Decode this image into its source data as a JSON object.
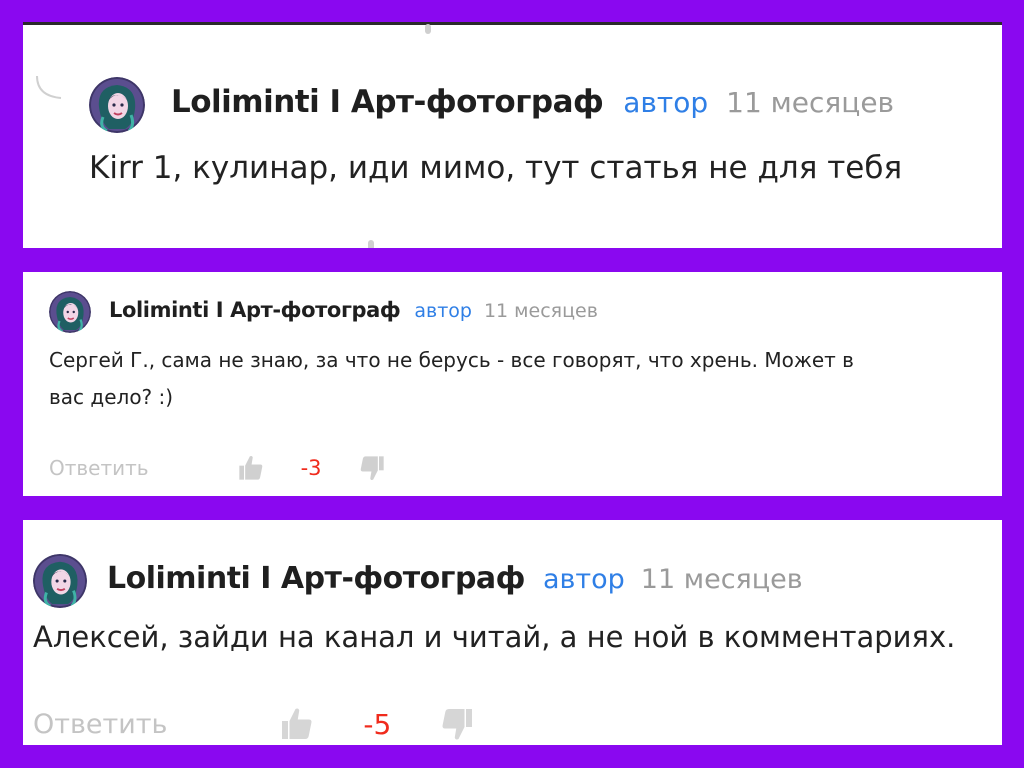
{
  "colors": {
    "background": "#8a08f0",
    "panel": "#ffffff",
    "author_badge": "#2f7fe6",
    "time": "#9a9a9a",
    "score_negative": "#f02b1d",
    "reply": "#c4c4c4"
  },
  "comments": [
    {
      "author": "Lolimintі I Арт-фотограф",
      "badge": "автор",
      "time": "11 месяцев",
      "text_lines": [
        "Kirr 1, кулинар, иди мимо, тут статья не для тебя"
      ],
      "avatar_icon": "avatar-icon"
    },
    {
      "author": "Lolimintі I Арт-фотограф",
      "badge": "автор",
      "time": "11 месяцев",
      "text_lines": [
        "Сергей Г., сама не знаю, за что не берусь - все говорят, что хрень. Может в",
        "вас дело? :)"
      ],
      "reply_label": "Ответить",
      "score": "-3",
      "like_icon": "thumbs-up-icon",
      "dislike_icon": "thumbs-down-icon",
      "avatar_icon": "avatar-icon"
    },
    {
      "author": "Lolimintі I Арт-фотограф",
      "badge": "автор",
      "time": "11 месяцев",
      "text_lines": [
        "Алексей, зайди на канал и читай, а не ной в комментариях."
      ],
      "reply_label": "Ответить",
      "score": "-5",
      "like_icon": "thumbs-up-icon",
      "dislike_icon": "thumbs-down-icon",
      "avatar_icon": "avatar-icon"
    }
  ]
}
